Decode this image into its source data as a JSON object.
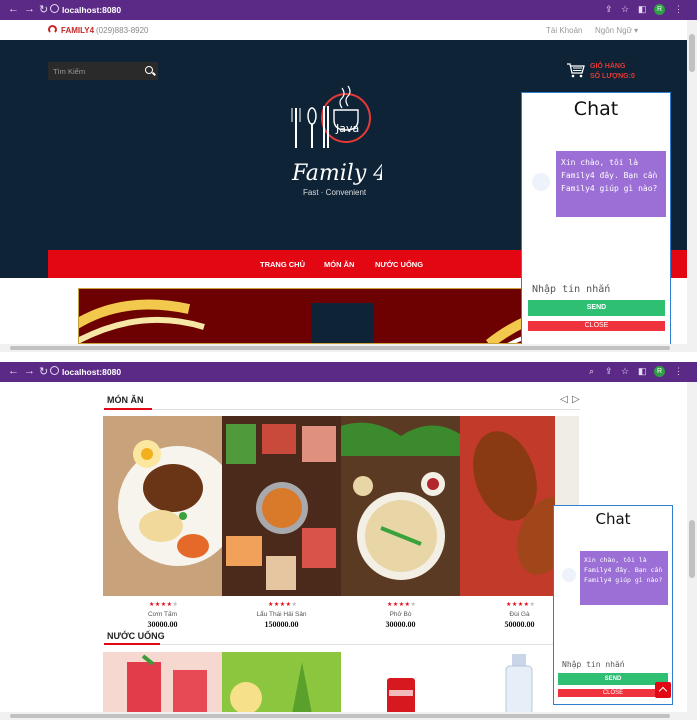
{
  "browser": {
    "url": "localhost:8080"
  },
  "topbar": {
    "brand": "FAMILY4",
    "phone": "(029)883-8920",
    "account": "Tài Khoản",
    "language": "Ngôn Ngữ"
  },
  "header": {
    "search_placeholder": "Tìm Kiếm",
    "cart_label": "GIỎ HÀNG",
    "cart_count_label": "SỐ LƯỢNG:0",
    "logo_text": "Java",
    "logo_script": "Family 4",
    "tagline": "Fast · Convenient"
  },
  "menu": {
    "items": [
      "TRANG CHỦ",
      "MÓN ĂN",
      "NƯỚC UỐNG"
    ]
  },
  "chat": {
    "title": "Chat",
    "greeting": "Xin chào, tôi là Family4 đây. Bạn cần Family4 giúp gì nào?",
    "input_placeholder": "Nhập tin nhắn",
    "send_label": "SEND",
    "close_label": "CLOSE"
  },
  "foods_section": {
    "title": "MÓN ĂN",
    "items": [
      {
        "name": "Cơm Tấm",
        "price": "30000.00",
        "rating": 4
      },
      {
        "name": "Lẩu Thái Hải Sản",
        "price": "150000.00",
        "rating": 4
      },
      {
        "name": "Phở Bò",
        "price": "30000.00",
        "rating": 4
      },
      {
        "name": "Đùi Gà",
        "price": "50000.00",
        "rating": 4
      }
    ]
  },
  "drinks_section": {
    "title": "NƯỚC UỐNG"
  },
  "colors": {
    "browser_bar": "#5b2a86",
    "header_bg": "#0f2336",
    "accent_red": "#e30613",
    "chat_bubble": "#9b6fd6",
    "send_green": "#2fbf73"
  }
}
